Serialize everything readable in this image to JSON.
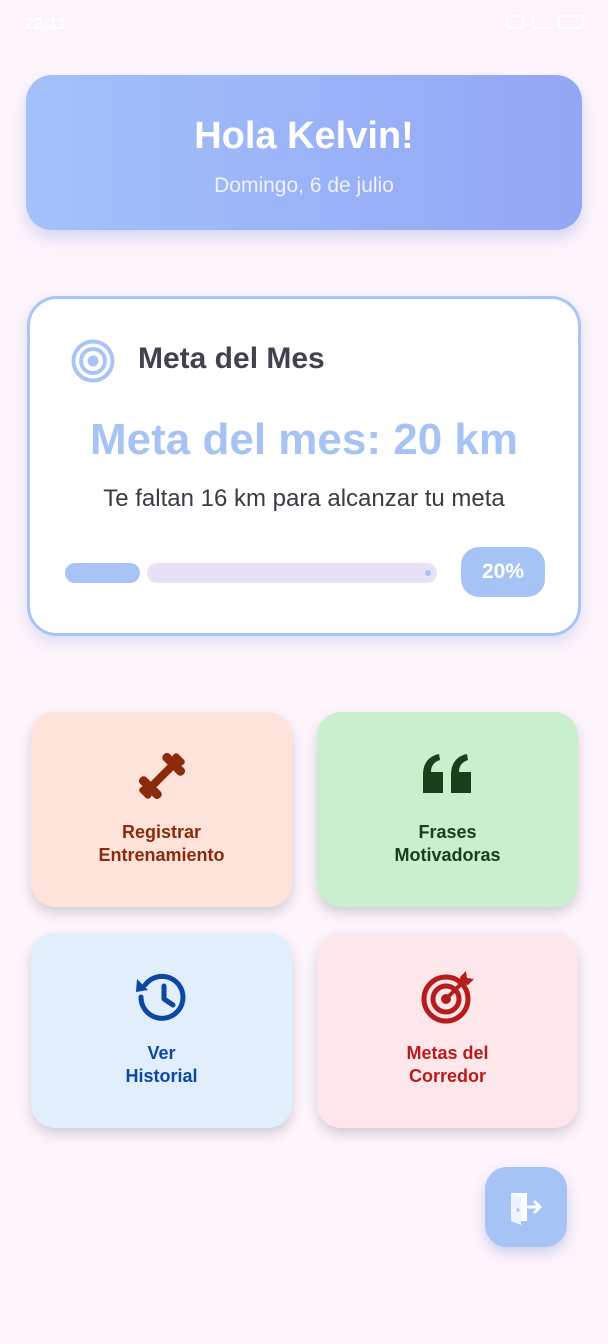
{
  "status_bar": {
    "time": "22:11",
    "icons": [
      "message-icon",
      "signal-icon",
      "battery-icon"
    ]
  },
  "header": {
    "greeting": "Hola Kelvin!",
    "date": "Domingo, 6 de julio"
  },
  "goal_card": {
    "icon": "target-icon",
    "title": "Meta del Mes",
    "amount_text": "Meta del mes: 20 km",
    "remaining_text": "Te faltan 16 km para alcanzar tu meta",
    "progress_fraction": 0.2,
    "progress_label": "20%"
  },
  "actions": [
    {
      "line1": "Registrar",
      "line2": "Entrenamiento",
      "icon": "dumbbell-icon",
      "color": "#8c2a0c"
    },
    {
      "line1": "Frases",
      "line2": "Motivadoras",
      "icon": "quote-icon",
      "color": "#17401a"
    },
    {
      "line1": "Ver",
      "line2": "Historial",
      "icon": "history-icon",
      "color": "#0d47a1"
    },
    {
      "line1": "Metas del",
      "line2": "Corredor",
      "icon": "bullseye-arrow-icon",
      "color": "#b71c1c"
    }
  ],
  "fab": {
    "icon": "logout-icon"
  },
  "colors": {
    "accent": "#a6c3f6",
    "background": "#fdf4fc",
    "title_text": "#44414f"
  }
}
